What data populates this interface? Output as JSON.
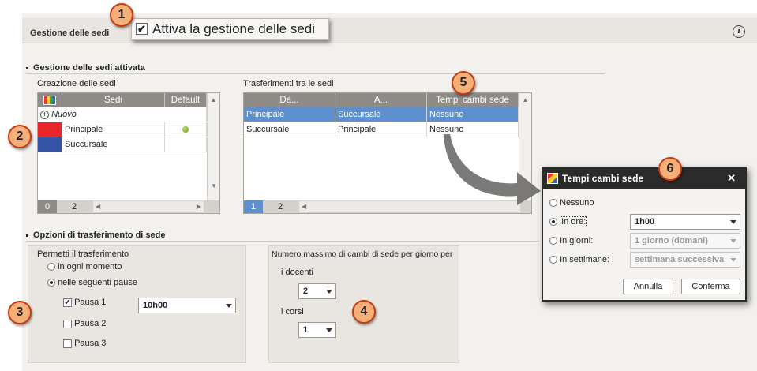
{
  "header": {
    "title": "Gestione delle sedi",
    "callout_label": "Attiva la gestione delle sedi",
    "info_icon": "i"
  },
  "badges": [
    "1",
    "2",
    "3",
    "4",
    "5",
    "6"
  ],
  "section_main": {
    "title": "Gestione delle sedi attivata"
  },
  "sedi": {
    "caption": "Creazione delle sedi",
    "columns": [
      "Sedi",
      "Default"
    ],
    "new_label": "Nuovo",
    "rows": [
      {
        "name": "Principale",
        "color": "#e8262b",
        "default": true
      },
      {
        "name": "Succursale",
        "color": "#3654a5",
        "default": false
      }
    ],
    "footer": {
      "selected": "0",
      "total": "2"
    }
  },
  "trasferimenti": {
    "caption": "Trasferimenti tra le sedi",
    "columns": [
      "Da...",
      "A...",
      "Tempi cambi sede"
    ],
    "rows": [
      {
        "da": "Principale",
        "a": "Succursale",
        "tempi": "Nessuno",
        "selected": true
      },
      {
        "da": "Succursale",
        "a": "Principale",
        "tempi": "Nessuno",
        "selected": false
      }
    ],
    "footer": {
      "selected": "1",
      "total": "2"
    }
  },
  "opzioni": {
    "title": "Opzioni di trasferimento di sede",
    "permetti": {
      "label": "Permetti il trasferimento",
      "options": [
        "in ogni momento",
        "nelle seguenti pause"
      ],
      "selected": 1,
      "pauses": [
        {
          "label": "Pausa 1",
          "checked": true
        },
        {
          "label": "Pausa 2",
          "checked": false
        },
        {
          "label": "Pausa 3",
          "checked": false
        }
      ],
      "pausa1_value": "10h00"
    },
    "massimo": {
      "label": "Numero massimo di cambi di sede per giorno per",
      "docenti_label": "i docenti",
      "docenti_value": "2",
      "corsi_label": "i corsi",
      "corsi_value": "1"
    }
  },
  "dialog": {
    "title": "Tempi cambi sede",
    "close": "✕",
    "options": [
      {
        "label": "Nessuno",
        "value": "",
        "selected": false
      },
      {
        "label": "In ore:",
        "value": "1h00",
        "selected": true
      },
      {
        "label": "In giorni:",
        "value": "1 giorno (domani)",
        "selected": false
      },
      {
        "label": "In settimane:",
        "value": "settimana successiva",
        "selected": false
      }
    ],
    "cancel": "Annulla",
    "confirm": "Conferma"
  }
}
